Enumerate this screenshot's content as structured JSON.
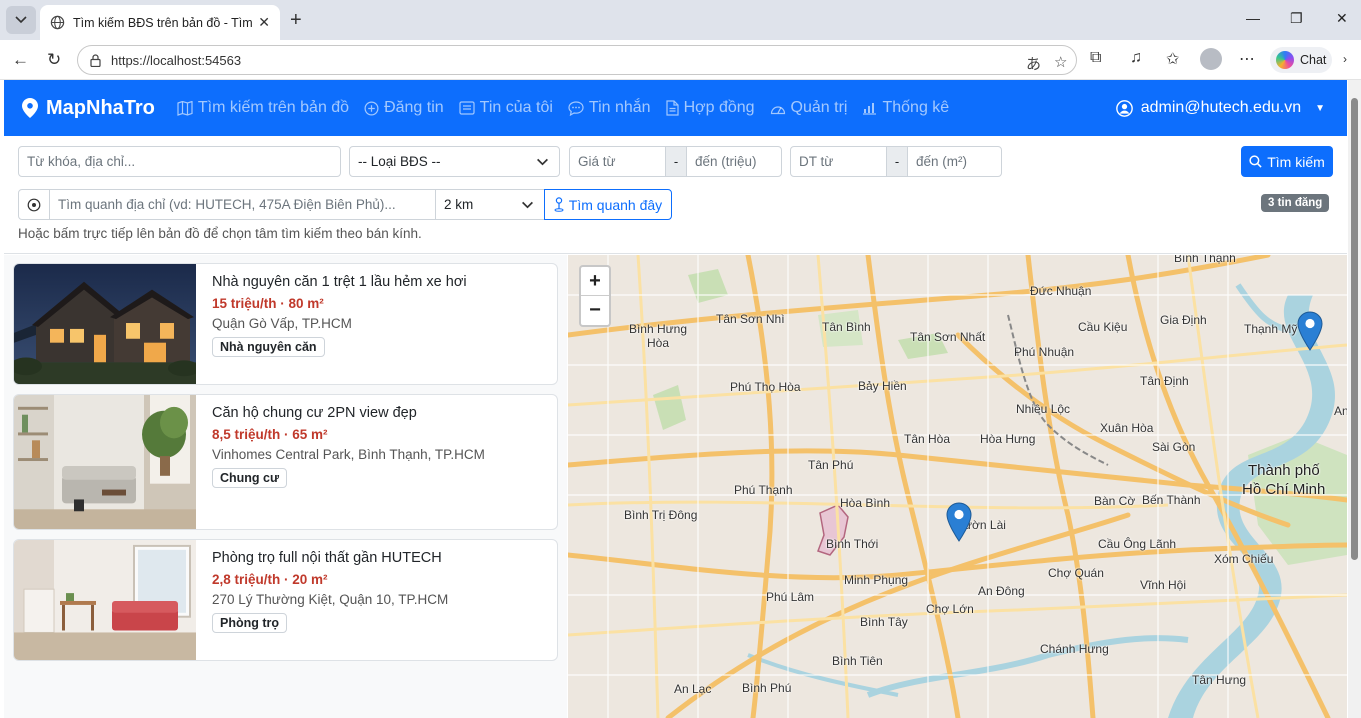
{
  "browser": {
    "tab_title": "Tìm kiếm BĐS trên bản đồ - Tìm &",
    "url": "https://localhost:54563",
    "chat_label": "Chat"
  },
  "navbar": {
    "brand": "MapNhaTro",
    "links": [
      {
        "label": "Tìm kiếm trên bản đồ",
        "icon": "map-icon"
      },
      {
        "label": "Đăng tin",
        "icon": "plus-circle-icon"
      },
      {
        "label": "Tin của tôi",
        "icon": "list-icon"
      },
      {
        "label": "Tin nhắn",
        "icon": "chat-icon"
      },
      {
        "label": "Hợp đồng",
        "icon": "document-icon"
      },
      {
        "label": "Quản trị",
        "icon": "gauge-icon"
      },
      {
        "label": "Thống kê",
        "icon": "bar-chart-icon"
      }
    ],
    "user": "admin@hutech.edu.vn"
  },
  "filters": {
    "keyword_placeholder": "Từ khóa, địa chỉ...",
    "type_value": "-- Loại BĐS --",
    "price_from_placeholder": "Giá từ",
    "price_sep": "-",
    "price_to_placeholder": "đến (triệu)",
    "area_from_placeholder": "DT từ",
    "area_sep": "-",
    "area_to_placeholder": "đến (m²)",
    "search_button": "Tìm kiếm",
    "nearby_placeholder": "Tìm quanh địa chỉ (vd: HUTECH, 475A Điện Biên Phủ)...",
    "radius_value": "2 km",
    "nearby_button": "Tìm quanh đây",
    "count_badge": "3 tin đăng",
    "hint": "Hoặc bấm trực tiếp lên bản đồ để chọn tâm tìm kiếm theo bán kính."
  },
  "listings": [
    {
      "title": "Nhà nguyên căn 1 trệt 1 lầu hẻm xe hơi",
      "price": "15 triệu/th · 80 m²",
      "address": "Quận Gò Vấp, TP.HCM",
      "tag": "Nhà nguyên căn"
    },
    {
      "title": "Căn hộ chung cư 2PN view đẹp",
      "price": "8,5 triệu/th · 65 m²",
      "address": "Vinhomes Central Park, Bình Thạnh, TP.HCM",
      "tag": "Chung cư"
    },
    {
      "title": "Phòng trọ full nội thất gần HUTECH",
      "price": "2,8 triệu/th · 20 m²",
      "address": "270 Lý Thường Kiệt, Quận 10, TP.HCM",
      "tag": "Phòng trọ"
    }
  ],
  "map": {
    "zoom_in": "+",
    "zoom_out": "−",
    "labels": [
      "Bình Thạnh",
      "Đức Nhuận",
      "Gia Định",
      "Thạnh Mỹ",
      "Bình Hưng Hòa",
      "Tân Sơn Nhì",
      "Tân Bình",
      "Tân Sơn Nhất",
      "Cầu Kiệu",
      "Phú Nhuận",
      "Tân Định",
      "Phú Thọ Hòa",
      "Bảy Hiền",
      "Nhiêu Lộc",
      "Tân Hòa",
      "Hòa Hưng",
      "Xuân Hòa",
      "Sài Gòn",
      "Tân Phú",
      "Phú Thạnh",
      "Hòa Bình",
      "Bàn Cờ",
      "Bến Thành",
      "Bình Trị Đông",
      "Bình Thới",
      "Vườn Lài",
      "Cầu Ông Lãnh",
      "Minh Phụng",
      "Chợ Quán",
      "Xóm Chiếu",
      "Phú Lâm",
      "An Đông",
      "Vĩnh Hội",
      "Chợ Lớn",
      "Bình Tây",
      "Chánh Hưng",
      "Bình Tiên",
      "An Lạc",
      "Bình Phú",
      "Tân Hưng",
      "Thành phố",
      "Hồ Chí Minh",
      "An"
    ]
  },
  "colors": {
    "primary": "#0d6efd",
    "price": "#c0392b",
    "marker": "#2a7fd4"
  }
}
